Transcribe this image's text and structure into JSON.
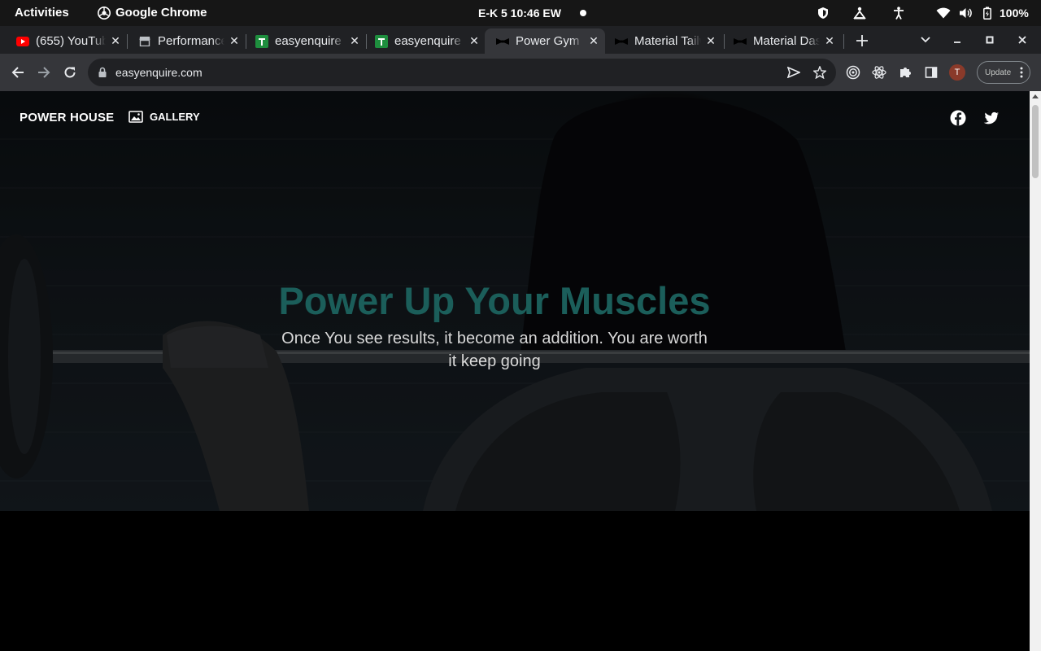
{
  "system_bar": {
    "activities": "Activities",
    "app_name": "Google Chrome",
    "clock": "E-K 5  10:46 EW",
    "battery": "100%"
  },
  "tabs": [
    {
      "title": "(655) YouTube",
      "icon": "youtube-icon"
    },
    {
      "title": "Performance",
      "icon": "store-icon"
    },
    {
      "title": "easyenquire",
      "icon": "sheets-icon"
    },
    {
      "title": "easyenquire",
      "icon": "sheets-icon"
    },
    {
      "title": "Power Gym",
      "icon": "bowtie-icon",
      "active": true
    },
    {
      "title": "Material Tailwind",
      "icon": "bowtie-icon"
    },
    {
      "title": "Material Dashboard",
      "icon": "bowtie-icon"
    }
  ],
  "toolbar": {
    "url": "easyenquire.com",
    "avatar_letter": "T",
    "update_label": "Update"
  },
  "site": {
    "brand": "POWER HOUSE",
    "nav_gallery": "GALLERY",
    "hero_title": "Power Up Your Muscles",
    "hero_subtitle": "Once You see results, it become an addition. You are worth it keep going"
  },
  "colors": {
    "hero_title": "#1b5e5a",
    "chrome_dark": "#202124",
    "chrome_toolbar": "#35363a"
  }
}
